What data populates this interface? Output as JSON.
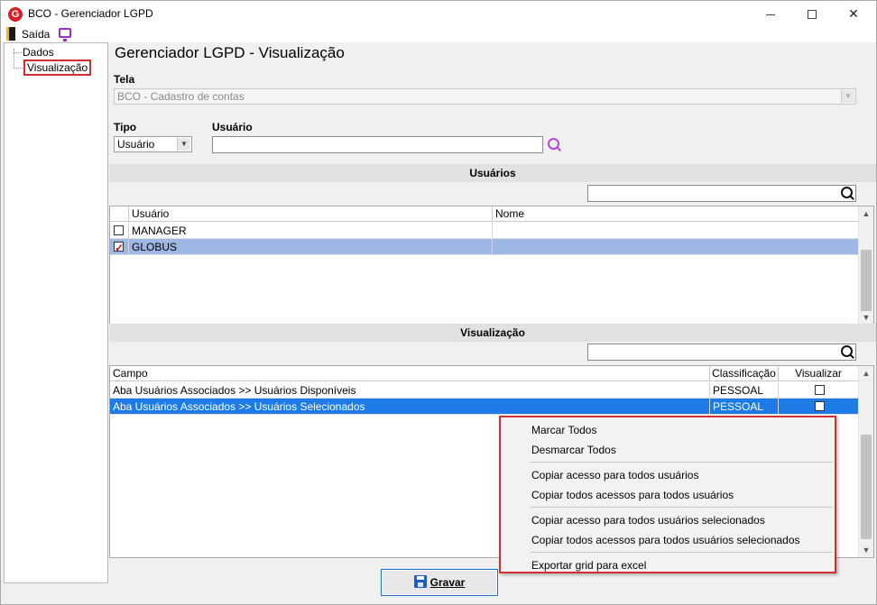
{
  "window": {
    "title": "BCO - Gerenciador LGPD",
    "app_icon_letter": "G",
    "minimize_icon": "minimize-icon",
    "maximize_icon": "maximize-icon",
    "close_icon": "close-icon"
  },
  "toolbar": {
    "exit_label": "Saída",
    "exit_icon": "exit-door-icon",
    "monitor_icon": "monitor-icon"
  },
  "tree": {
    "items": [
      {
        "label": "Dados",
        "selected": false
      },
      {
        "label": "Visualização",
        "selected": true
      }
    ]
  },
  "main": {
    "title": "Gerenciador LGPD - Visualização",
    "tela": {
      "label": "Tela",
      "value": "BCO - Cadastro de contas",
      "disabled": true
    },
    "tipo": {
      "label": "Tipo",
      "value": "Usuário"
    },
    "usuario": {
      "label": "Usuário",
      "value": "",
      "search_icon": "search-icon"
    }
  },
  "usuarios_section": {
    "header": "Usuários",
    "filter_value": "",
    "columns": [
      "Usuário",
      "Nome"
    ],
    "rows": [
      {
        "checked": false,
        "usuario": "MANAGER",
        "nome": "",
        "selected": false
      },
      {
        "checked": true,
        "usuario": "GLOBUS",
        "nome": "",
        "selected": true
      }
    ]
  },
  "visualizacao_section": {
    "header": "Visualização",
    "filter_value": "",
    "columns": [
      "Campo",
      "Classificação",
      "Visualizar"
    ],
    "rows": [
      {
        "campo": "Aba Usuários Associados >> Usuários Disponíveis",
        "classificacao": "PESSOAL",
        "visualizar": false,
        "selected": false
      },
      {
        "campo": "Aba Usuários Associados >> Usuários Selecionados",
        "classificacao": "PESSOAL",
        "visualizar": false,
        "selected": true
      }
    ]
  },
  "context_menu": {
    "items": [
      "Marcar Todos",
      "Desmarcar Todos",
      "Copiar acesso para todos usuários",
      "Copiar todos acessos para todos usuários",
      "Copiar acesso para todos usuários selecionados",
      "Copiar todos acessos para todos usuários selecionados",
      "Exportar grid para excel"
    ]
  },
  "footer": {
    "save_label": "Gravar",
    "save_icon": "floppy-disk-icon"
  },
  "colors": {
    "highlight_red": "#d32f2f",
    "selection_blue": "#1e7be6",
    "selection_light": "#9fb7e4",
    "accent_purple": "#b04ad8"
  }
}
